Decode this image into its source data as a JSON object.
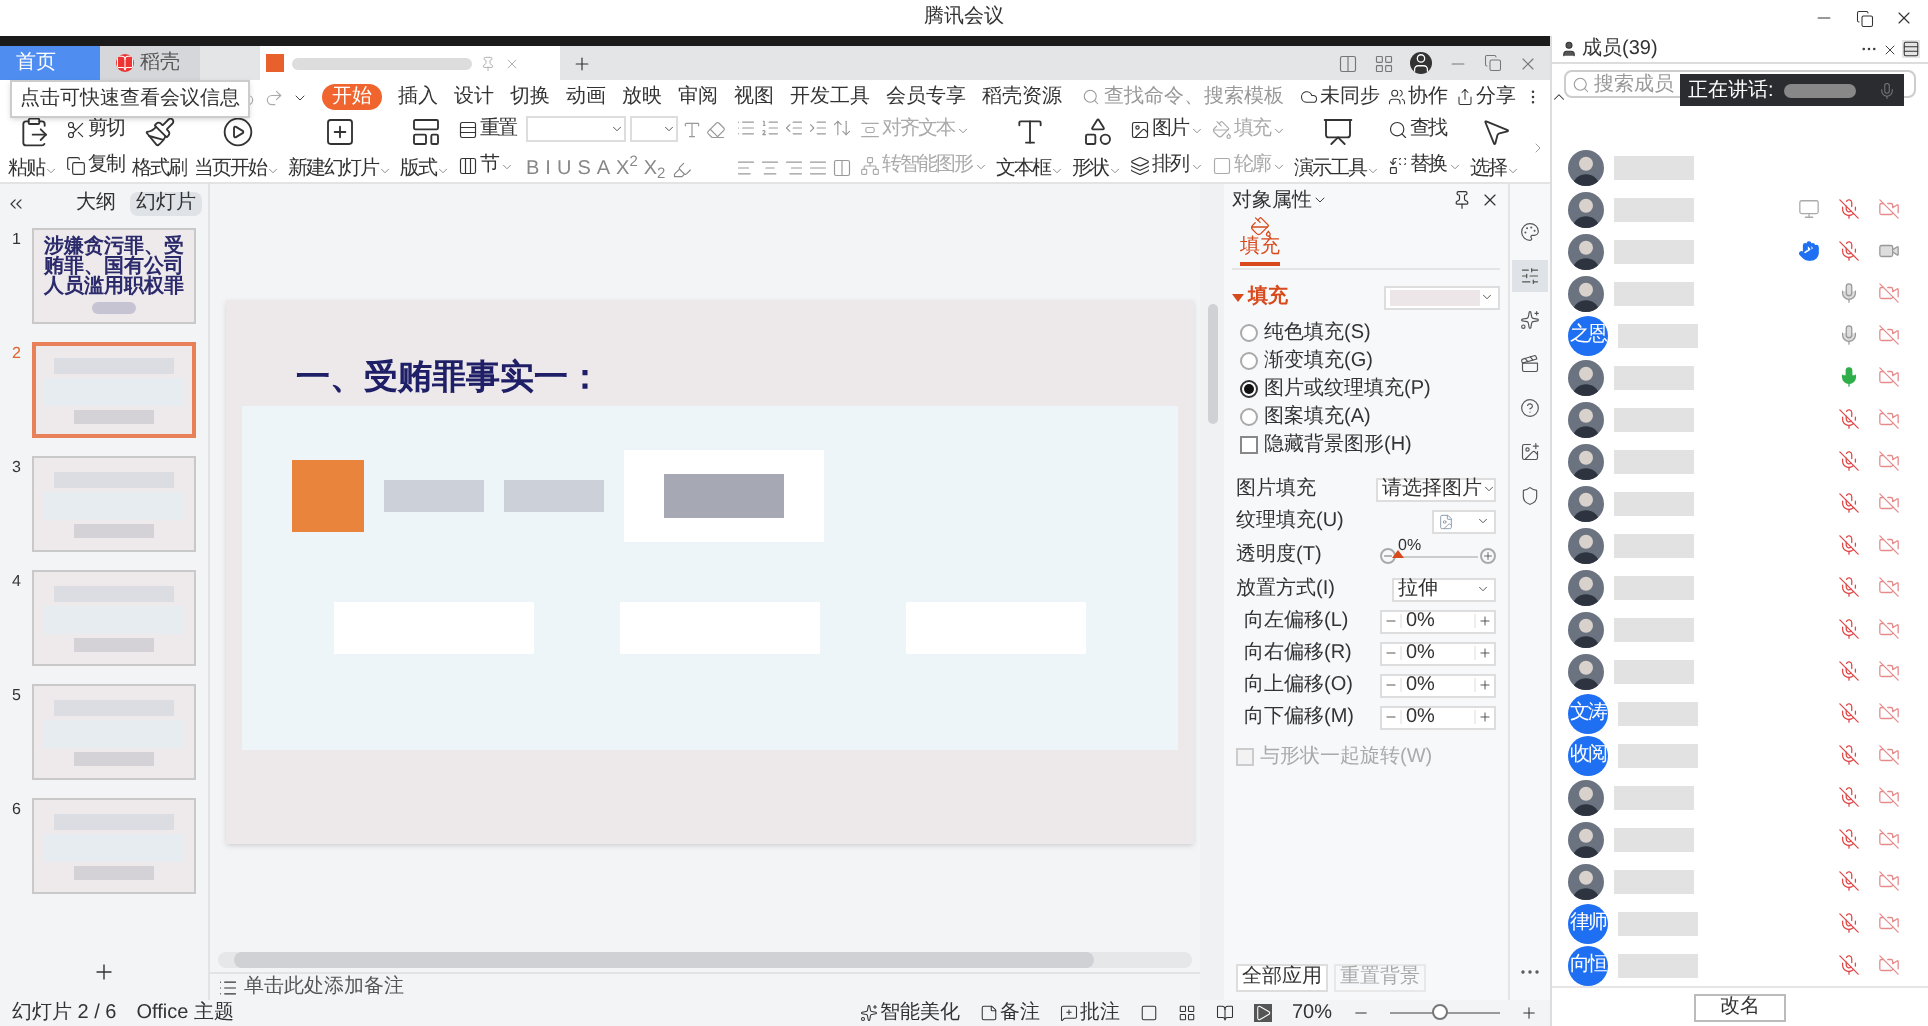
{
  "window": {
    "title": "腾讯会议"
  },
  "app_tabs": [
    {
      "label": "首页",
      "selected": true
    },
    {
      "label": "稻壳",
      "selected": false
    }
  ],
  "tooltip": "点击可快速查看会议信息",
  "ribbon_tabs": [
    {
      "label": "开始",
      "selected": true
    },
    {
      "label": "插入",
      "selected": false
    },
    {
      "label": "设计",
      "selected": false
    },
    {
      "label": "切换",
      "selected": false
    },
    {
      "label": "动画",
      "selected": false
    },
    {
      "label": "放映",
      "selected": false
    },
    {
      "label": "审阅",
      "selected": false
    },
    {
      "label": "视图",
      "selected": false
    },
    {
      "label": "开发工具",
      "selected": false
    },
    {
      "label": "会员专享",
      "selected": false
    },
    {
      "label": "稻壳资源",
      "selected": false
    }
  ],
  "search": {
    "placeholder": "查找命令、搜索模板"
  },
  "ribbon_actions": [
    "未同步",
    "协作",
    "分享"
  ],
  "toolbar": [
    {
      "kind": "big",
      "label": "粘贴",
      "dropdown": true
    },
    {
      "kind": "stack",
      "disabled": false,
      "items": [
        {
          "label": "剪切",
          "dropdown": false
        },
        {
          "label": "复制",
          "dropdown": false
        }
      ]
    },
    {
      "kind": "big",
      "label": "格式刷",
      "dropdown": false
    },
    {
      "kind": "big",
      "label": "当页开始",
      "dropdown": true
    },
    {
      "kind": "big",
      "label": "新建幻灯片",
      "dropdown": true
    },
    {
      "kind": "big",
      "label": "版式",
      "dropdown": true
    },
    {
      "kind": "stack",
      "disabled": false,
      "items": [
        {
          "label": "重置",
          "dropdown": false
        },
        {
          "label": "节",
          "dropdown": true
        }
      ]
    },
    {
      "kind": "font",
      "buttons": [
        "B",
        "I",
        "U",
        "S",
        "A",
        "X$^{2}$",
        "X$_{2}$"
      ]
    },
    {
      "kind": "paragraph"
    },
    {
      "kind": "stack",
      "disabled": true,
      "items": [
        {
          "label": "对齐文本",
          "dropdown": true
        },
        {
          "label": "转智能图形",
          "dropdown": true
        }
      ]
    },
    {
      "kind": "big",
      "label": "文本框",
      "dropdown": true
    },
    {
      "kind": "big",
      "label": "形状",
      "dropdown": true
    },
    {
      "kind": "stack",
      "disabled": false,
      "items": [
        {
          "label": "图片",
          "dropdown": true
        },
        {
          "label": "排列",
          "dropdown": true
        }
      ]
    },
    {
      "kind": "stack",
      "disabled": true,
      "items": [
        {
          "label": "填充",
          "dropdown": true
        },
        {
          "label": "轮廓",
          "dropdown": true
        }
      ]
    },
    {
      "kind": "big",
      "label": "演示工具",
      "dropdown": true
    },
    {
      "kind": "stack",
      "disabled": false,
      "items": [
        {
          "label": "查找",
          "dropdown": false
        },
        {
          "label": "替换",
          "dropdown": true
        }
      ]
    },
    {
      "kind": "big",
      "label": "选择",
      "dropdown": true
    }
  ],
  "slides_panel": {
    "tabs": [
      {
        "label": "大纲",
        "selected": false
      },
      {
        "label": "幻灯片",
        "selected": true
      }
    ],
    "thumbnails": [
      {
        "number": "1",
        "selected": false,
        "text": "涉嫌贪污罪、受贿罪、国有公司人员滥用职权罪"
      },
      {
        "number": "2",
        "selected": true
      },
      {
        "number": "3",
        "selected": false
      },
      {
        "number": "4",
        "selected": false
      },
      {
        "number": "5",
        "selected": false
      },
      {
        "number": "6",
        "selected": false
      }
    ]
  },
  "slide": {
    "title": "一、受贿罪事实一："
  },
  "notes": {
    "placeholder": "单击此处添加备注"
  },
  "properties": {
    "title": "对象属性",
    "tab": {
      "label": "填充",
      "selected": true
    },
    "section": {
      "label": "填充",
      "expanded": true
    },
    "fill_options": [
      {
        "label": "纯色填充(S)",
        "selected": false
      },
      {
        "label": "渐变填充(G)",
        "selected": false
      },
      {
        "label": "图片或纹理填充(P)",
        "selected": true
      },
      {
        "label": "图案填充(A)",
        "selected": false
      }
    ],
    "hide_background": {
      "label": "隐藏背景图形(H)",
      "checked": false
    },
    "picture_fill": {
      "label": "图片填充",
      "value": "请选择图片"
    },
    "texture_fill": {
      "label": "纹理填充(U)"
    },
    "transparency": {
      "label": "透明度(T)",
      "reading": "0%",
      "level": 0
    },
    "placement": {
      "label": "放置方式(I)",
      "value": "拉伸"
    },
    "offsets": [
      {
        "label": "向左偏移(L)",
        "value": "0%"
      },
      {
        "label": "向右偏移(R)",
        "value": "0%"
      },
      {
        "label": "向上偏移(O)",
        "value": "0%"
      },
      {
        "label": "向下偏移(M)",
        "value": "0%"
      }
    ],
    "rotate": {
      "label": "与形状一起旋转(W)",
      "checked": false,
      "disabled": true
    },
    "buttons": [
      {
        "label": "全部应用",
        "disabled": false
      },
      {
        "label": "重置背景",
        "disabled": true
      }
    ]
  },
  "side_tools": [
    {
      "selected": false
    },
    {
      "selected": true
    },
    {
      "selected": false
    },
    {
      "selected": false
    },
    {
      "selected": false
    },
    {
      "selected": false
    },
    {
      "selected": false
    }
  ],
  "status_bar": {
    "left": [
      "幻灯片 2 / 6",
      "Office 主题"
    ],
    "beautify": "智能美化",
    "notes": "备注",
    "comments": "批注",
    "zoom": "70%",
    "zoom_slider": {
      "level": 0.45
    }
  },
  "members": {
    "title": "成员(39)",
    "search_placeholder": "搜索成员",
    "speaking": "正在讲话: ",
    "list": [
      {
        "kind": "photo",
        "icons_shown": false
      },
      {
        "kind": "photo",
        "icons_shown": true,
        "sharing_screen": true,
        "muted": true,
        "camera_on": false
      },
      {
        "kind": "photo",
        "icons_shown": true,
        "sharing_screen": false,
        "hand_raised": true,
        "muted": true,
        "camera_on": true
      },
      {
        "kind": "photo",
        "icons_shown": true,
        "sharing_screen": false,
        "hand_raised": false,
        "muted": false,
        "speaking": false,
        "camera_on": false
      },
      {
        "kind": "initials",
        "initials": "之恩",
        "icons_shown": true,
        "sharing_screen": false,
        "hand_raised": false,
        "muted": false,
        "speaking": false,
        "camera_on": false
      },
      {
        "kind": "photo",
        "icons_shown": true,
        "sharing_screen": false,
        "hand_raised": false,
        "muted": false,
        "speaking": true,
        "camera_on": false
      },
      {
        "kind": "photo",
        "icons_shown": true,
        "sharing_screen": false,
        "hand_raised": false,
        "muted": true,
        "camera_on": false
      },
      {
        "kind": "photo",
        "icons_shown": true,
        "sharing_screen": false,
        "hand_raised": false,
        "muted": true,
        "camera_on": false
      },
      {
        "kind": "photo",
        "icons_shown": true,
        "sharing_screen": false,
        "hand_raised": false,
        "muted": true,
        "camera_on": false
      },
      {
        "kind": "photo",
        "icons_shown": true,
        "sharing_screen": false,
        "hand_raised": false,
        "muted": true,
        "camera_on": false
      },
      {
        "kind": "photo",
        "icons_shown": true,
        "sharing_screen": false,
        "hand_raised": false,
        "muted": true,
        "camera_on": false
      },
      {
        "kind": "photo",
        "icons_shown": true,
        "sharing_screen": false,
        "hand_raised": false,
        "muted": true,
        "camera_on": false
      },
      {
        "kind": "photo",
        "icons_shown": true,
        "sharing_screen": false,
        "hand_raised": false,
        "muted": true,
        "camera_on": false
      },
      {
        "kind": "initials",
        "initials": "文涛",
        "icons_shown": true,
        "sharing_screen": false,
        "hand_raised": false,
        "muted": true,
        "camera_on": false
      },
      {
        "kind": "initials",
        "initials": "收阅",
        "icons_shown": true,
        "sharing_screen": false,
        "hand_raised": false,
        "muted": true,
        "camera_on": false
      },
      {
        "kind": "photo",
        "icons_shown": true,
        "sharing_screen": false,
        "hand_raised": false,
        "muted": true,
        "camera_on": false
      },
      {
        "kind": "photo",
        "icons_shown": true,
        "sharing_screen": false,
        "hand_raised": false,
        "muted": true,
        "camera_on": false
      },
      {
        "kind": "photo",
        "icons_shown": true,
        "sharing_screen": false,
        "hand_raised": false,
        "muted": true,
        "camera_on": false
      },
      {
        "kind": "initials",
        "initials": "律师",
        "icons_shown": true,
        "sharing_screen": false,
        "hand_raised": false,
        "muted": true,
        "camera_on": false
      },
      {
        "kind": "initials",
        "initials": "向恒",
        "icons_shown": true,
        "sharing_screen": false,
        "hand_raised": false,
        "muted": true,
        "camera_on": false
      }
    ],
    "button": "改名"
  }
}
